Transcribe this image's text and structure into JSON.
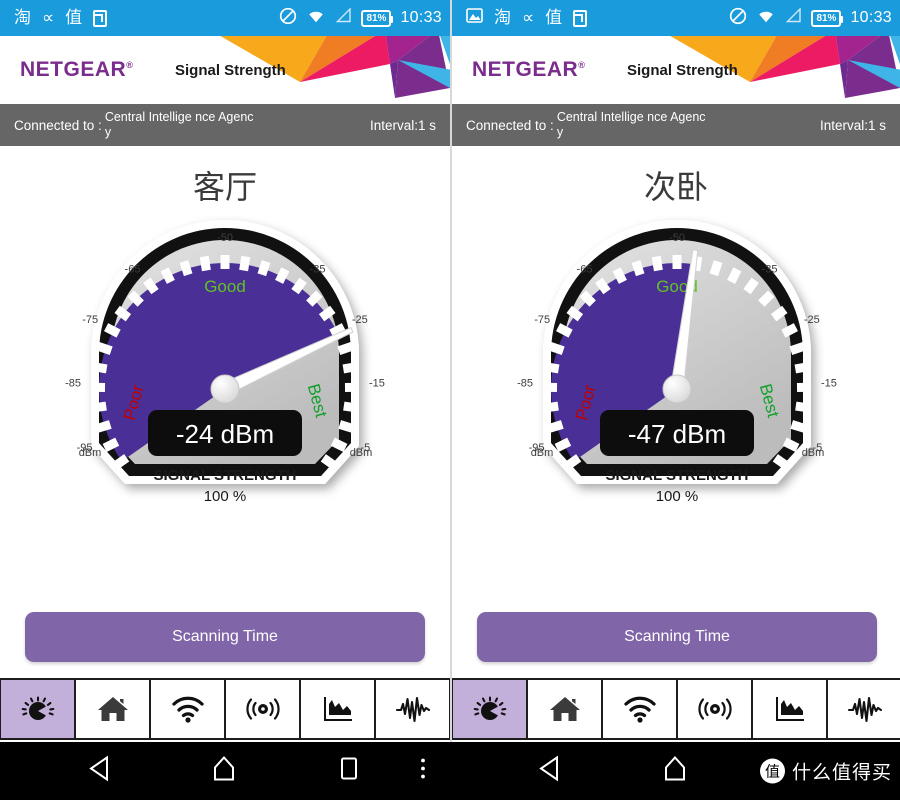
{
  "statusbar": {
    "left_icons_left_panel": [
      "taobao-icon",
      "curve-icon",
      "zhi-icon",
      "app-square-icon"
    ],
    "left_icons_right_panel": [
      "photo-icon",
      "taobao-icon",
      "curve-icon",
      "zhi-icon",
      "app-square-icon"
    ],
    "taobao_glyph": "淘",
    "curve_glyph": "∝",
    "zhi_glyph": "值",
    "dnd_icon": "do-not-disturb-icon",
    "wifi_icon": "wifi-icon",
    "signal_icon": "cell-signal-icon",
    "battery_text": "81%",
    "time": "10:33",
    "bg_color": "#1a9bdc"
  },
  "header": {
    "brand": "NETGEAR",
    "brand_mark": "®",
    "title": "Signal Strength",
    "brand_color": "#7b2d8e",
    "art_colors": [
      "#f7a81b",
      "#f07d23",
      "#ec1b63",
      "#a3248e",
      "#6e2b8f",
      "#3fb4e6",
      "#72cdf0"
    ]
  },
  "connection": {
    "label": "Connected to :",
    "ssid": "Central Intellige nce Agency",
    "interval": "Interval:1 s",
    "bg_color": "#666666"
  },
  "panels": [
    {
      "room_title": "客厅",
      "gauge": {
        "value_text": "-24 dBm",
        "value_dbm": -24,
        "strength_label": "SIGNAL STRENGTH",
        "percent_text": "100 %",
        "zone_poor": "Poor",
        "zone_good": "Good",
        "zone_best": "Best",
        "unit_left": "dBm",
        "unit_right": "dBm",
        "tick_labels": [
          "-95",
          "-85",
          "-75",
          "-65",
          "-50",
          "-35",
          "-25",
          "-15",
          "-5"
        ],
        "scale_min": -100,
        "scale_max": 0,
        "fill_color": "#4a2f96",
        "track_color": "#c9c9c9",
        "poor_color": "#c00000",
        "good_color": "#62c124",
        "best_color": "#12a02c"
      },
      "scan_button": "Scanning Time"
    },
    {
      "room_title": "次卧",
      "gauge": {
        "value_text": "-47 dBm",
        "value_dbm": -47,
        "strength_label": "SIGNAL STRENGTH",
        "percent_text": "100 %",
        "zone_poor": "Poor",
        "zone_good": "Good",
        "zone_best": "Best",
        "unit_left": "dBm",
        "unit_right": "dBm",
        "tick_labels": [
          "-95",
          "-85",
          "-75",
          "-65",
          "-50",
          "-35",
          "-25",
          "-15",
          "-5"
        ],
        "scale_min": -100,
        "scale_max": 0,
        "fill_color": "#4a2f96",
        "track_color": "#c9c9c9",
        "poor_color": "#c00000",
        "good_color": "#62c124",
        "best_color": "#12a02c"
      },
      "scan_button": "Scanning Time"
    }
  ],
  "tabs": [
    {
      "name": "gauge-tab",
      "icon": "gauge-icon",
      "active": true
    },
    {
      "name": "home-tab",
      "icon": "home-icon",
      "active": false
    },
    {
      "name": "wifi-tab",
      "icon": "wifi-icon",
      "active": false
    },
    {
      "name": "router-tab",
      "icon": "router-signal-icon",
      "active": false
    },
    {
      "name": "chart-tab",
      "icon": "bar-chart-icon",
      "active": false
    },
    {
      "name": "waveform-tab",
      "icon": "waveform-icon",
      "active": false
    }
  ],
  "tab_active_color": "#c3b0da",
  "navbar": {
    "back_icon": "back-triangle-icon",
    "home_icon": "home-pentagon-icon",
    "recents_icon": "recents-square-icon",
    "menu_icon": "overflow-menu-icon",
    "watermark_badge": "值",
    "watermark_text": "什么值得买"
  }
}
